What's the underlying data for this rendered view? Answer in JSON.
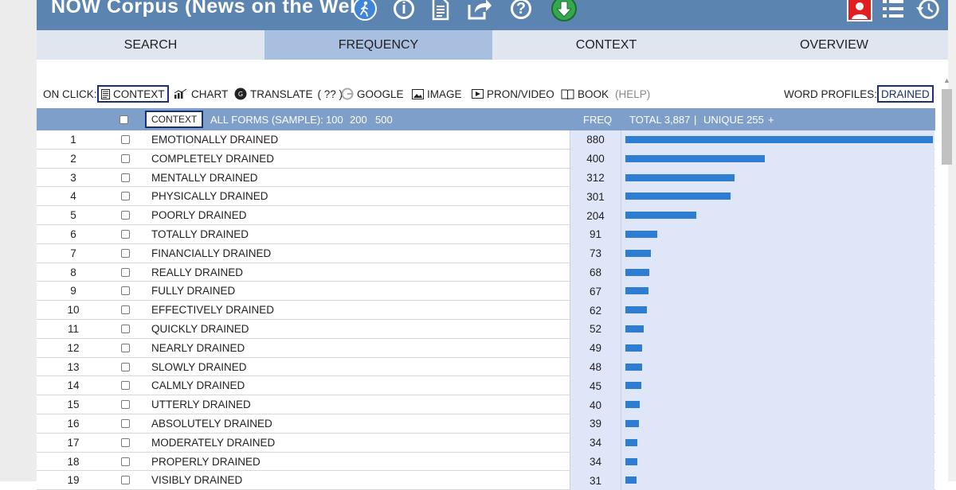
{
  "app": {
    "title": "NOW Corpus (News on the Web)"
  },
  "toolbar": {
    "icons": [
      "tour-walk-icon",
      "info-icon",
      "document-icon",
      "share-icon",
      "help-icon",
      "download-icon",
      "user-icon",
      "list-icon",
      "history-icon"
    ],
    "walk_label": "TOUR",
    "help_glyph": "?",
    "info_glyph": "i"
  },
  "nav": {
    "tabs": [
      "SEARCH",
      "FREQUENCY",
      "CONTEXT",
      "OVERVIEW"
    ],
    "active": "FREQUENCY"
  },
  "options": {
    "on_click_label": "ON CLICK:",
    "context": "CONTEXT",
    "chart": "CHART",
    "translate": "TRANSLATE",
    "translate_q": "( ?? )",
    "google": "GOOGLE",
    "image": "IMAGE",
    "pron": "PRON/VIDEO",
    "book": "BOOK",
    "help": "(HELP)",
    "word_profiles_label": "WORD PROFILES:",
    "word_profiles_value": "DRAINED"
  },
  "table_header": {
    "context_btn": "CONTEXT",
    "all_forms": "ALL FORMS (SAMPLE):",
    "sample_100": "100",
    "sample_200": "200",
    "sample_500": "500",
    "freq": "FREQ",
    "total": "TOTAL 3,887",
    "sep": "|",
    "unique": "UNIQUE 255",
    "plus": "+"
  },
  "colors": {
    "topbar": "#5b84b1",
    "nav_active": "#a9bfdf",
    "header": "#7d9fc9",
    "bar": "#2d7dd2",
    "freq_bg": "#dfe6f8"
  },
  "rows": [
    {
      "n": "1",
      "word": "EMOTIONALLY DRAINED",
      "freq": "880",
      "value": 880
    },
    {
      "n": "2",
      "word": "COMPLETELY DRAINED",
      "freq": "400",
      "value": 400
    },
    {
      "n": "3",
      "word": "MENTALLY DRAINED",
      "freq": "312",
      "value": 312
    },
    {
      "n": "4",
      "word": "PHYSICALLY DRAINED",
      "freq": "301",
      "value": 301
    },
    {
      "n": "5",
      "word": "POORLY DRAINED",
      "freq": "204",
      "value": 204
    },
    {
      "n": "6",
      "word": "TOTALLY DRAINED",
      "freq": "91",
      "value": 91
    },
    {
      "n": "7",
      "word": "FINANCIALLY DRAINED",
      "freq": "73",
      "value": 73
    },
    {
      "n": "8",
      "word": "REALLY DRAINED",
      "freq": "68",
      "value": 68
    },
    {
      "n": "9",
      "word": "FULLY DRAINED",
      "freq": "67",
      "value": 67
    },
    {
      "n": "10",
      "word": "EFFECTIVELY DRAINED",
      "freq": "62",
      "value": 62
    },
    {
      "n": "11",
      "word": "QUICKLY DRAINED",
      "freq": "52",
      "value": 52
    },
    {
      "n": "12",
      "word": "NEARLY DRAINED",
      "freq": "49",
      "value": 49
    },
    {
      "n": "13",
      "word": "SLOWLY DRAINED",
      "freq": "48",
      "value": 48
    },
    {
      "n": "14",
      "word": "CALMLY DRAINED",
      "freq": "45",
      "value": 45
    },
    {
      "n": "15",
      "word": "UTTERLY DRAINED",
      "freq": "40",
      "value": 40
    },
    {
      "n": "16",
      "word": "ABSOLUTELY DRAINED",
      "freq": "39",
      "value": 39
    },
    {
      "n": "17",
      "word": "MODERATELY DRAINED",
      "freq": "34",
      "value": 34
    },
    {
      "n": "18",
      "word": "PROPERLY DRAINED",
      "freq": "34",
      "value": 34
    },
    {
      "n": "19",
      "word": "VISIBLY DRAINED",
      "freq": "31",
      "value": 31
    }
  ]
}
